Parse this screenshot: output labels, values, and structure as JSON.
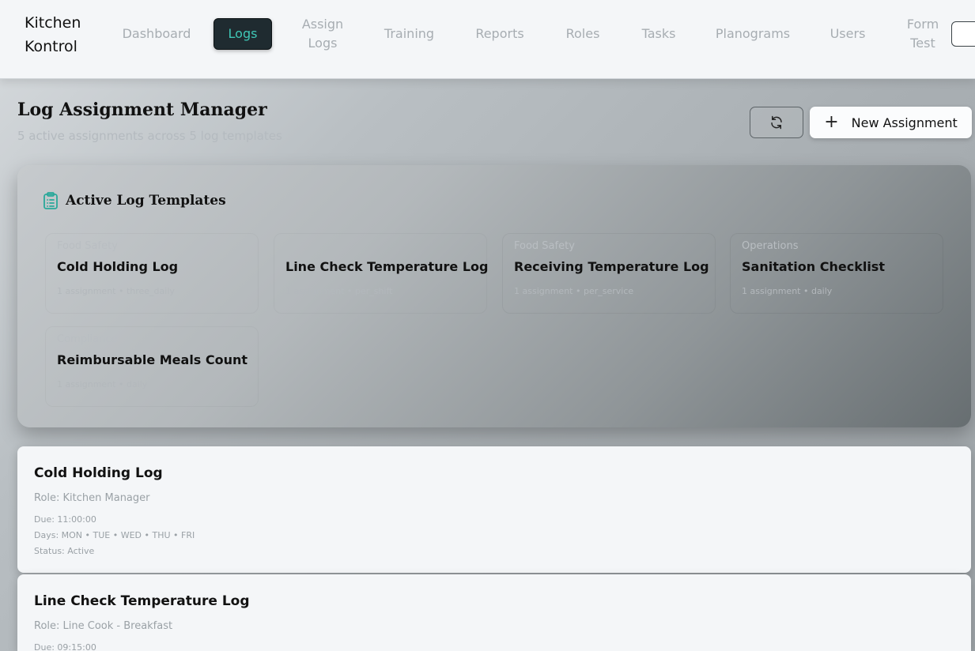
{
  "brand": {
    "line1": "Kitchen",
    "line2": "Kontrol"
  },
  "nav": {
    "dashboard": "Dashboard",
    "logs": "Logs",
    "assign_logs_1": "Assign",
    "assign_logs_2": "Logs",
    "training": "Training",
    "reports": "Reports",
    "roles": "Roles",
    "tasks": "Tasks",
    "planograms": "Planograms",
    "users": "Users",
    "form_test_1": "Form",
    "form_test_2": "Test"
  },
  "header": {
    "title": "Log Assignment Manager",
    "subtitle": "5 active assignments across 5 log templates",
    "refresh_icon": "refresh-icon",
    "new_button_label": "New Assignment"
  },
  "templates": {
    "title": "Active Log Templates",
    "icon": "clipboard-icon",
    "items": [
      {
        "category": "Food Safety",
        "name": "Cold Holding Log",
        "meta": "1 assignment • three_daily"
      },
      {
        "category": "",
        "name": "Line Check Temperature Log",
        "meta": "1 assignment • per_shift"
      },
      {
        "category": "Food Safety",
        "name": "Receiving Temperature Log",
        "meta": "1 assignment • per_service"
      },
      {
        "category": "Operations",
        "name": "Sanitation Checklist",
        "meta": "1 assignment • daily"
      },
      {
        "category": "Compliance",
        "name": "Reimbursable Meals Count",
        "meta": "1 assignment • daily"
      }
    ]
  },
  "assignments": [
    {
      "title": "Cold Holding Log",
      "role": "Role: Kitchen Manager",
      "due": "Due: 11:00:00",
      "days": "Days: MON • TUE • WED • THU • FRI",
      "status": "Status: Active"
    },
    {
      "title": "Line Check Temperature Log",
      "role": "Role: Line Cook - Breakfast",
      "due": "Due: 09:15:00"
    }
  ],
  "colors": {
    "accent": "#3fc7b6",
    "nav_active_bg": "#1f2b30",
    "icon_teal": "#2aa89a"
  }
}
